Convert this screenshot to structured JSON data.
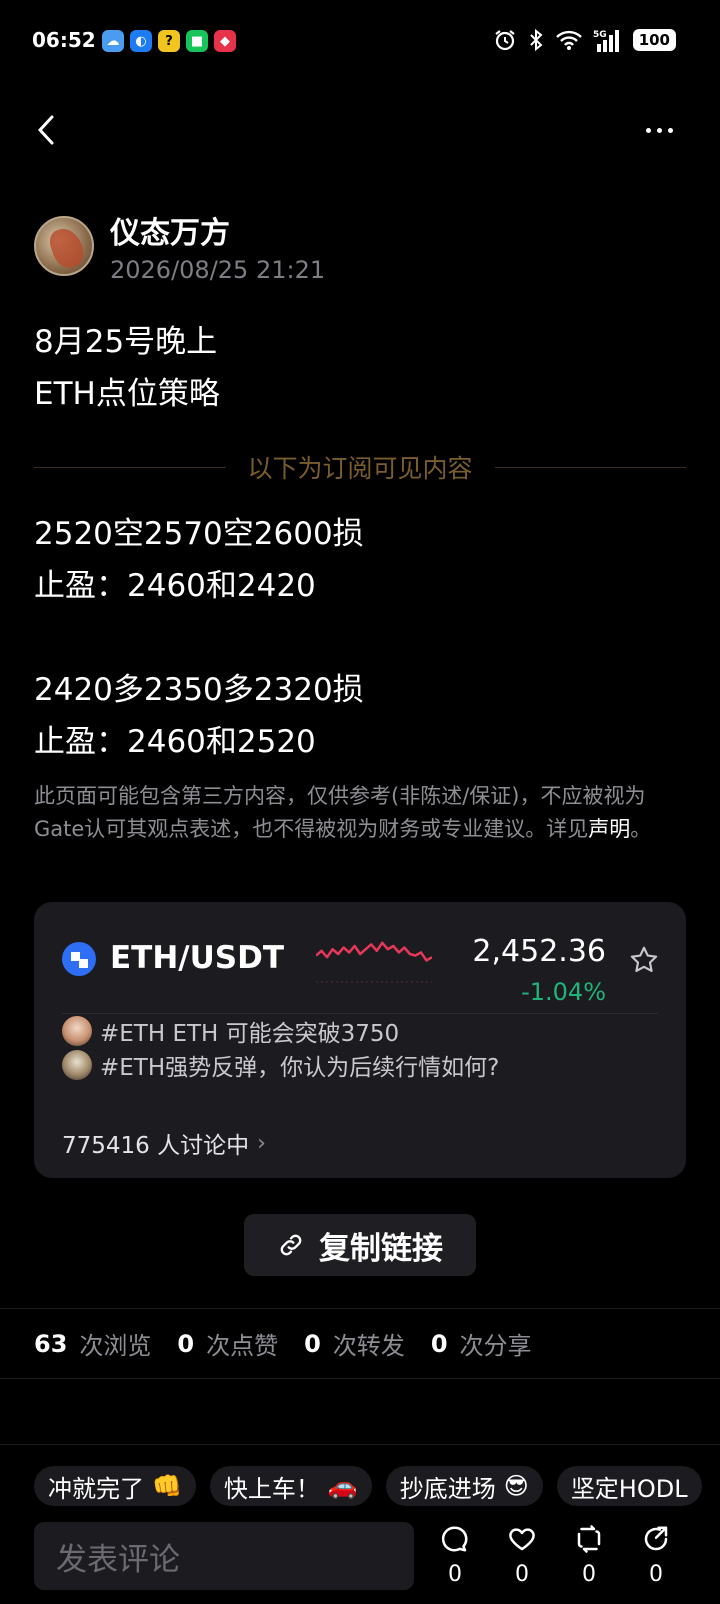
{
  "status_bar": {
    "time": "06:52",
    "network": "5G",
    "battery": "100"
  },
  "author": {
    "name": "仪态万方",
    "time": "2026/08/25 21:21"
  },
  "post": {
    "title_lines": [
      "8月25号晚上",
      "ETH点位策略"
    ],
    "subscriber_divider": "以下为订阅可见内容",
    "strategy_lines": [
      "2520空2570空2600损",
      "止盈：2460和2420",
      "",
      "2420多2350多2320损",
      "止盈：2460和2520"
    ],
    "disclaimer": "此页面可能包含第三方内容，仅供参考(非陈述/保证)，不应被视为Gate认可其观点表述，也不得被视为财务或专业建议。详见",
    "disclaimer_link": "声明",
    "disclaimer_end": "。"
  },
  "ticker": {
    "pair": "ETH/USDT",
    "price": "2,452.36",
    "change": "-1.04%",
    "sparkline": [
      0.55,
      0.4,
      0.6,
      0.35,
      0.5,
      0.3,
      0.45,
      0.25,
      0.5,
      0.35,
      0.2,
      0.4,
      0.15,
      0.35,
      0.25,
      0.45,
      0.3,
      0.5,
      0.55,
      0.45,
      0.7,
      0.6
    ],
    "topics": [
      "#ETH ETH 可能会突破3750",
      "#ETH强势反弹，你认为后续行情如何?"
    ],
    "discussion": "775416 人讨论中",
    "colors": {
      "down": "#e8385a",
      "change": "#22b37a"
    }
  },
  "copy_link": "复制链接",
  "stats": {
    "views": "63",
    "views_label": "次浏览",
    "likes": "0",
    "likes_label": "次点赞",
    "reposts": "0",
    "reposts_label": "次转发",
    "shares": "0",
    "shares_label": "次分享"
  },
  "quick_replies": [
    {
      "text": "冲就完了",
      "emoji": "👊"
    },
    {
      "text": "快上车！",
      "emoji": "🚗"
    },
    {
      "text": "抄底进场",
      "emoji": "😎"
    },
    {
      "text": "坚定HODL",
      "emoji": ""
    }
  ],
  "bottom_bar": {
    "comment_placeholder": "发表评论",
    "comment_count": "0",
    "like_count": "0",
    "repost_count": "0",
    "share_count": "0"
  }
}
